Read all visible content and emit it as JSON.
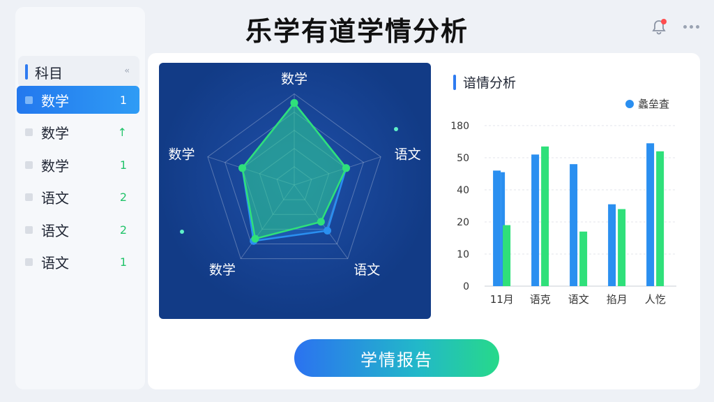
{
  "app": {
    "title": "乐学有道学情分析"
  },
  "sidebar": {
    "header_label": "科目",
    "collapse_glyph": "‹‹",
    "items": [
      {
        "label": "数学",
        "value": "1",
        "active": true
      },
      {
        "label": "数学",
        "value": "↑",
        "active": false
      },
      {
        "label": "数学",
        "value": "1",
        "active": false
      },
      {
        "label": "语文",
        "value": "2",
        "active": false
      },
      {
        "label": "语文",
        "value": "2",
        "active": false
      },
      {
        "label": "语文",
        "value": "1",
        "active": false
      }
    ]
  },
  "radar": {
    "axes": [
      "数学",
      "语文",
      "语文",
      "数学",
      "数学"
    ],
    "max": 10,
    "series": [
      {
        "values": [
          9.0,
          6.0,
          6.2,
          7.6,
          6.0
        ],
        "color": "#2a8ff0"
      },
      {
        "values": [
          9.0,
          6.0,
          5.0,
          7.3,
          6.0
        ],
        "color": "#2fe07a"
      }
    ]
  },
  "bar_panel": {
    "title": "谙情分析",
    "legend": "蠡垒査"
  },
  "chart_data": {
    "type": "bar",
    "categories": [
      "11月",
      "语克",
      "语文",
      "掐月",
      "人忔"
    ],
    "y_ticks": [
      "0",
      "10",
      "20",
      "40",
      "50",
      "180"
    ],
    "ylim": [
      0,
      100
    ],
    "series": [
      {
        "values": [
          72,
          82,
          76,
          51,
          89
        ],
        "color": "#2a8ff0"
      },
      {
        "values": [
          71,
          0,
          0,
          0,
          0
        ],
        "color": "#2a8ff0"
      },
      {
        "values": [
          38,
          87,
          34,
          48,
          84
        ],
        "color": "#2fe07a"
      }
    ],
    "grid": true
  },
  "footer": {
    "report_button": "学情报告"
  },
  "colors": {
    "accent": "#2378ee",
    "green": "#22c36a",
    "panel": "#123b86"
  }
}
